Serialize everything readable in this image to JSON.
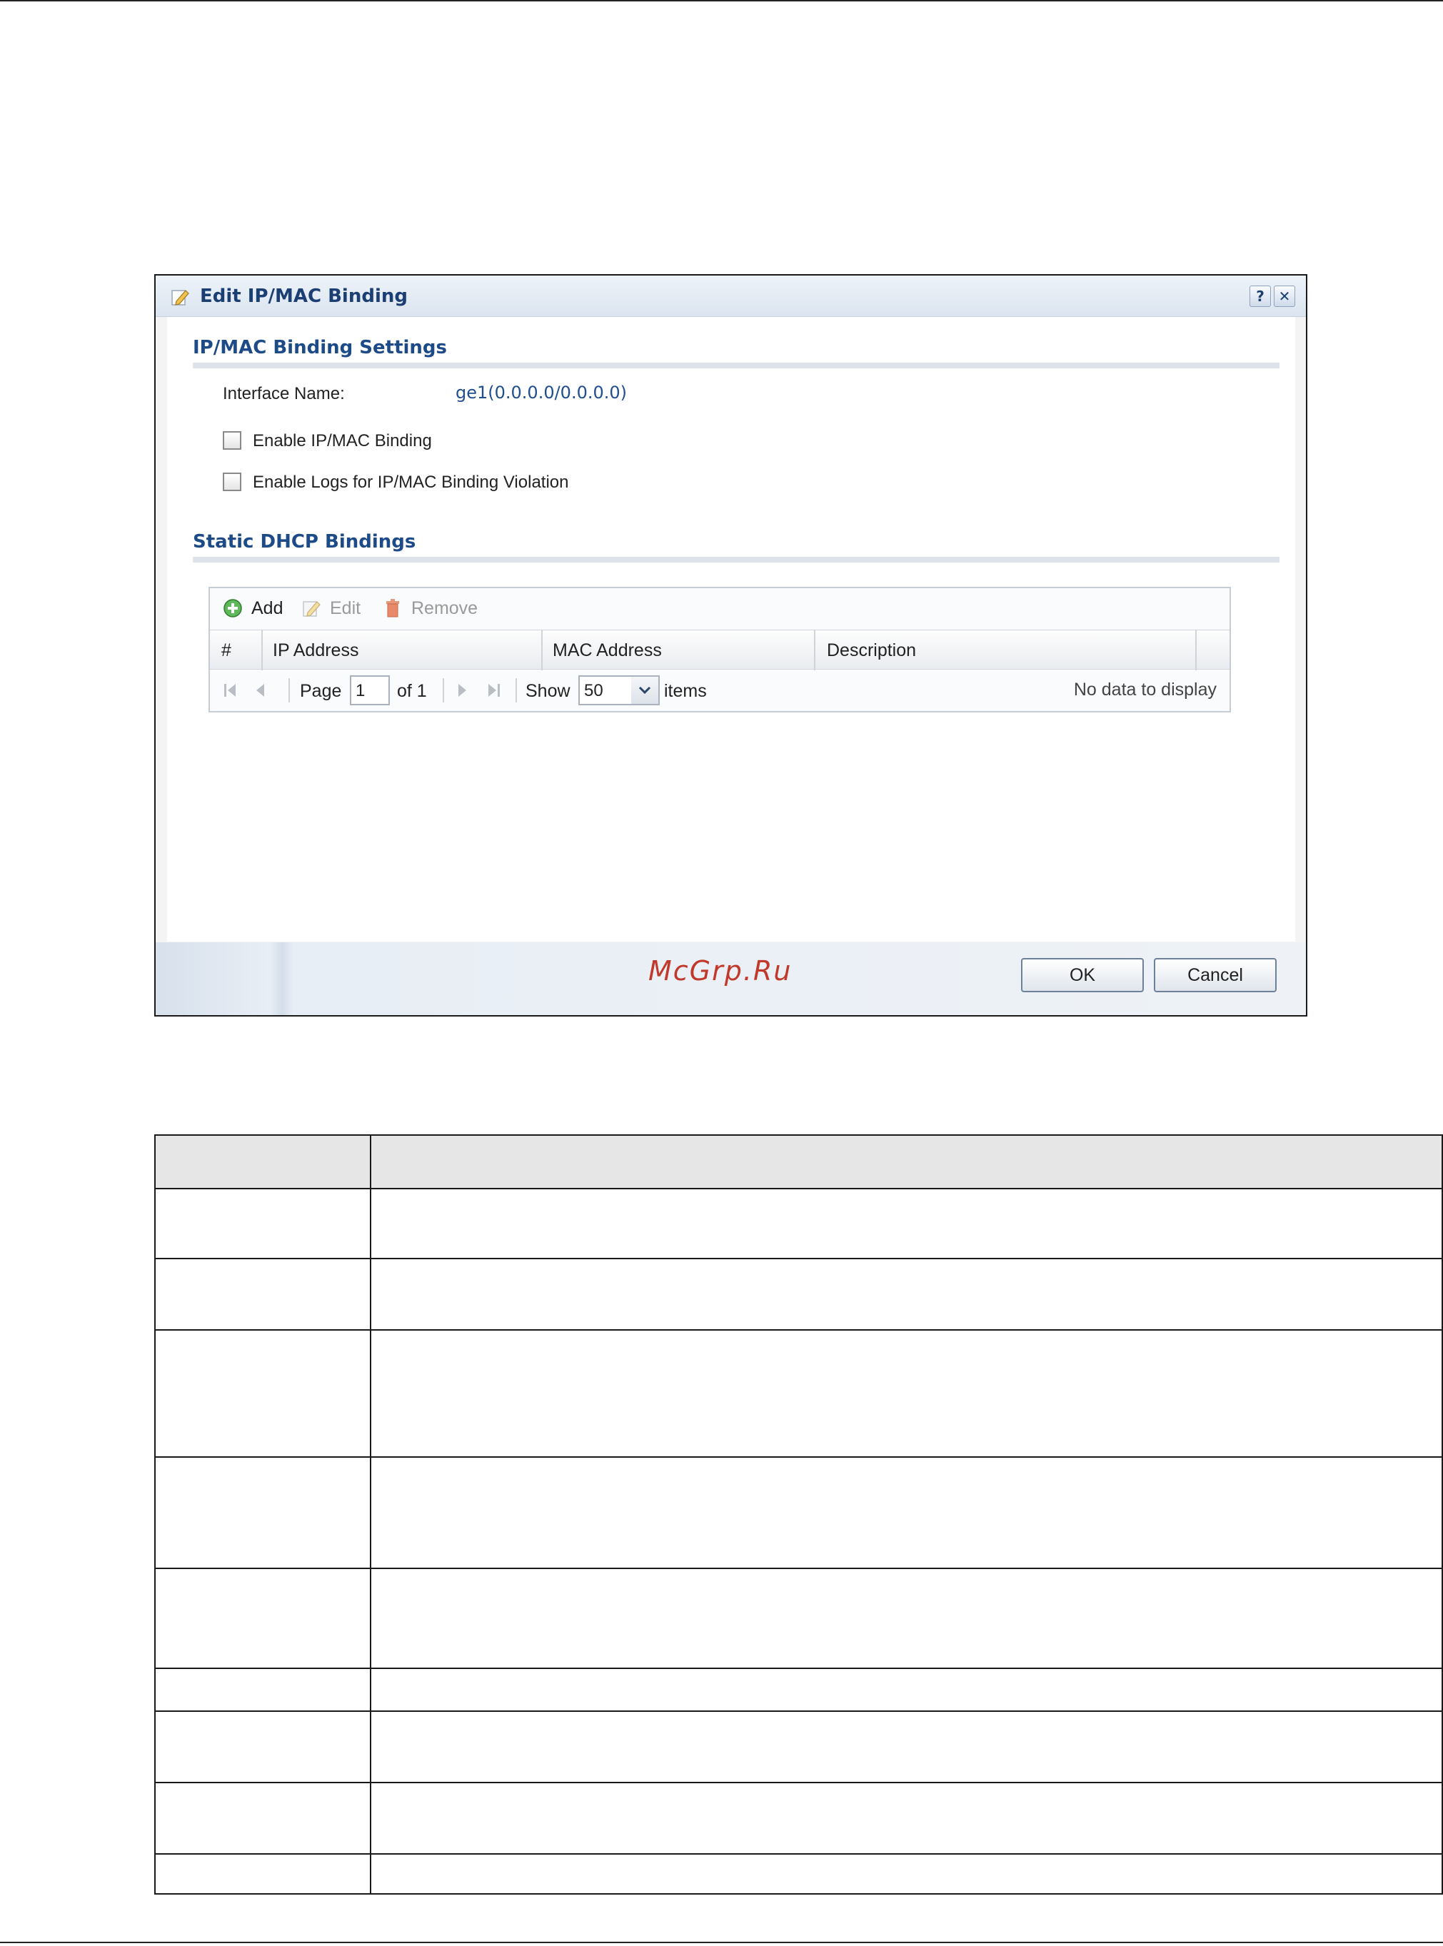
{
  "dialog": {
    "title": "Edit IP/MAC Binding",
    "help_label": "?",
    "close_label": "✕",
    "settings_section": "IP/MAC Binding Settings",
    "interface_label": "Interface Name:",
    "interface_value": "ge1(0.0.0.0/0.0.0.0)",
    "enable_binding_label": "Enable IP/MAC Binding",
    "enable_logs_label": "Enable Logs for IP/MAC Binding Violation",
    "bindings_section": "Static DHCP Bindings",
    "toolbar": {
      "add": "Add",
      "edit": "Edit",
      "remove": "Remove"
    },
    "columns": [
      "#",
      "IP Address",
      "MAC Address",
      "Description"
    ],
    "pager": {
      "page_label": "Page",
      "page_value": "1",
      "of_label": "of 1",
      "show_label": "Show",
      "show_value": "50",
      "items_label": "items",
      "no_data": "No data to display"
    },
    "watermark": "McGrp.Ru",
    "ok_label": "OK",
    "cancel_label": "Cancel"
  },
  "icons": {
    "edit_title": "pencil-icon",
    "add": "plus-circle-icon",
    "edit": "pencil-icon",
    "remove": "trash-icon"
  },
  "colors": {
    "section_title": "#1d4b88",
    "link": "#1f4f8f",
    "watermark": "#c0392b"
  }
}
